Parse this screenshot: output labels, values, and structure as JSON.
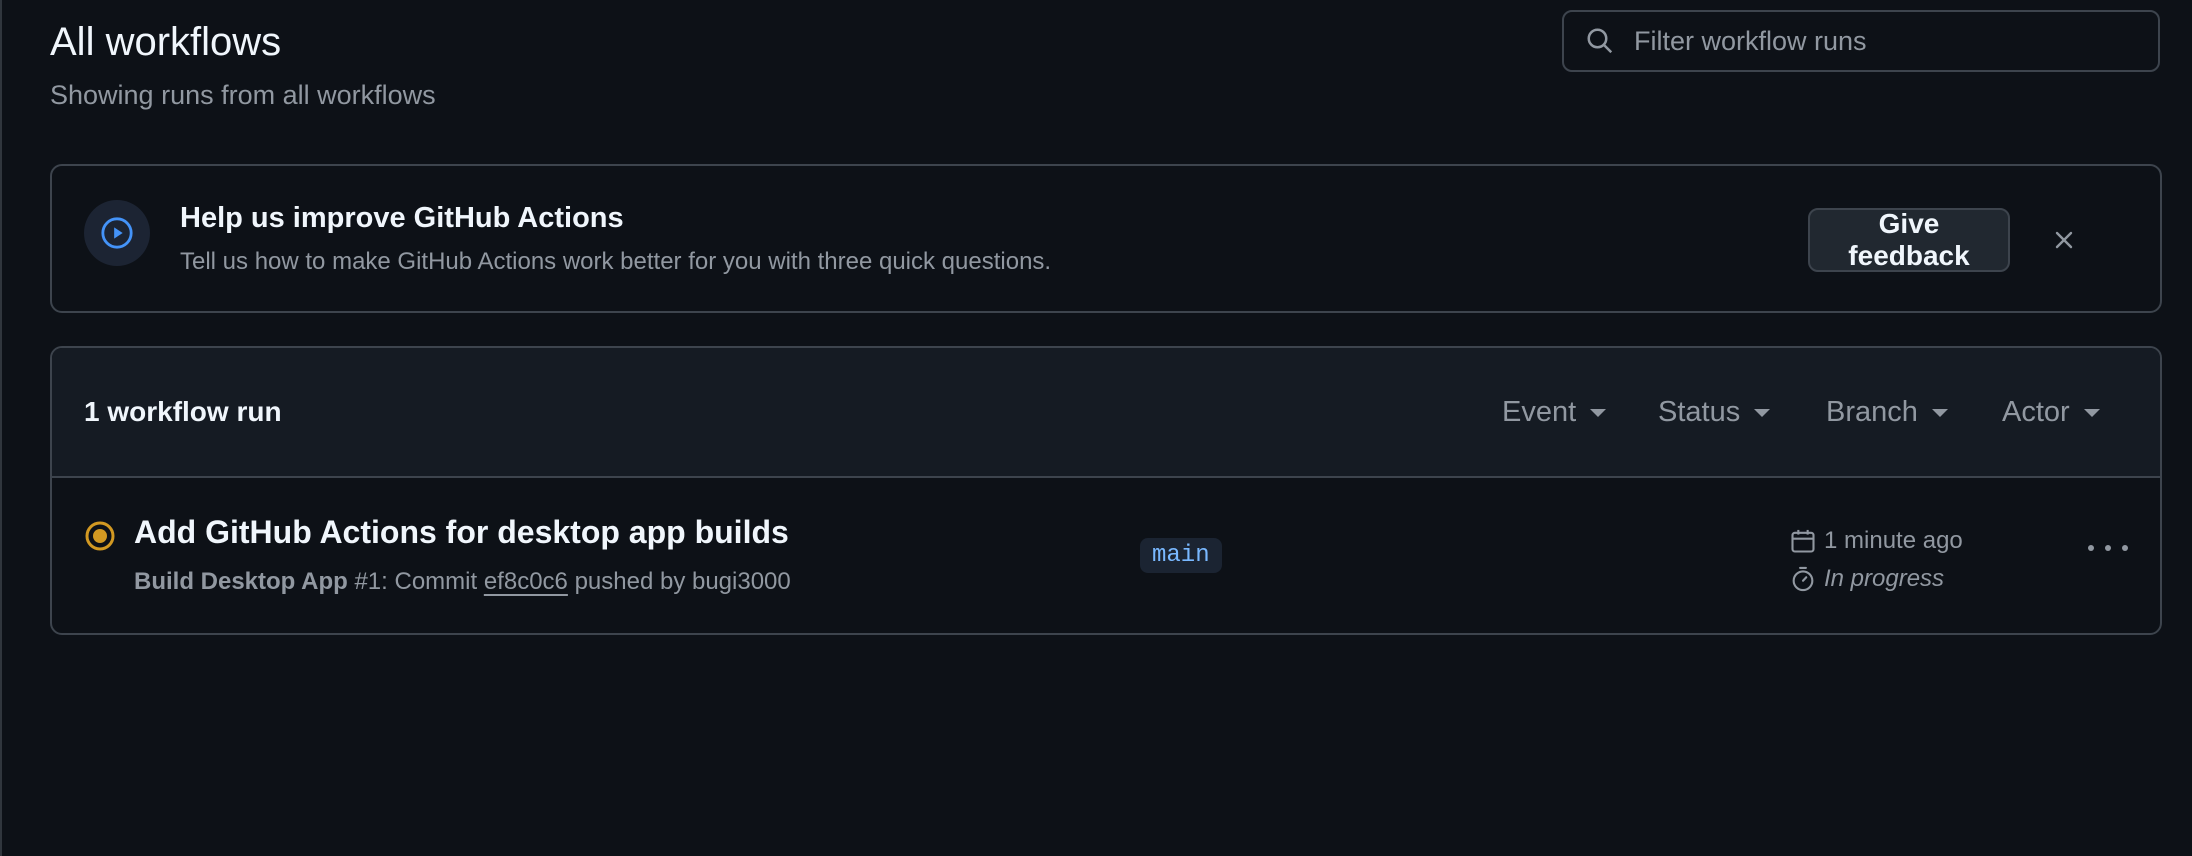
{
  "header": {
    "title": "All workflows",
    "subtitle": "Showing runs from all workflows"
  },
  "search": {
    "placeholder": "Filter workflow runs",
    "icon": "search-icon"
  },
  "banner": {
    "icon": "play-circle-icon",
    "title": "Help us improve GitHub Actions",
    "description": "Tell us how to make GitHub Actions work better for you with three quick questions.",
    "button_label": "Give feedback",
    "close_icon": "close-icon"
  },
  "runs": {
    "count_label": "1 workflow run",
    "filters": [
      "Event",
      "Status",
      "Branch",
      "Actor"
    ],
    "items": [
      {
        "status": "in-progress",
        "title": "Add GitHub Actions for desktop app builds",
        "workflow": "Build Desktop App",
        "run_number": "#1",
        "commit_prefix": ": Commit",
        "commit_sha": "ef8c0c6",
        "pushed_by": "pushed by bugi3000",
        "branch": "main",
        "time": "1 minute ago",
        "duration": "In progress"
      }
    ]
  },
  "colors": {
    "background": "#0d1117",
    "border": "#3d444d",
    "accent_blue": "#4493f8",
    "status_yellow": "#d29922",
    "branch_text": "#79b8ff"
  }
}
